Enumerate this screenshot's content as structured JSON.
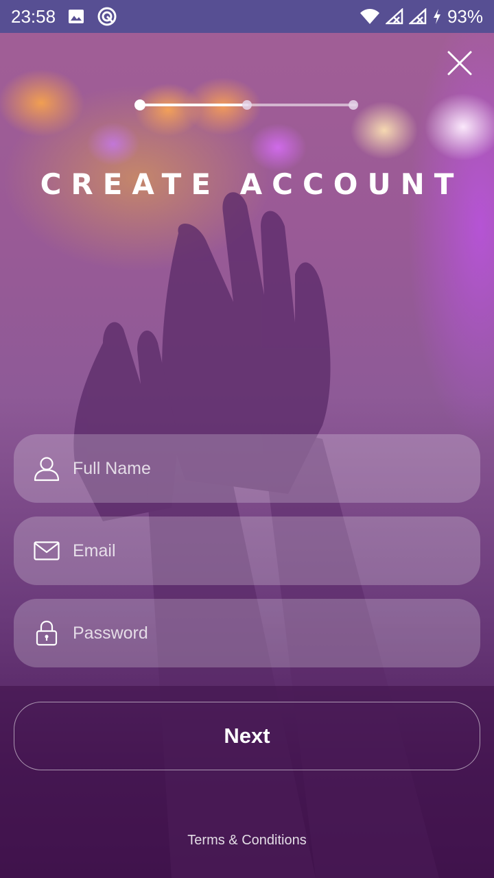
{
  "status_bar": {
    "time": "23:58",
    "battery_percent": "93%",
    "icons": [
      "image-icon",
      "sync-icon",
      "wifi-icon",
      "signal-1-icon",
      "signal-2-icon",
      "charging-icon"
    ]
  },
  "close_icon": "close-icon",
  "stepper": {
    "total_steps": 3,
    "current_step": 1,
    "progress_fraction": 0.5
  },
  "title": "CREATE ACCOUNT",
  "form": {
    "full_name": {
      "placeholder": "Full Name",
      "value": "",
      "icon": "user-icon"
    },
    "email": {
      "placeholder": "Email",
      "value": "",
      "icon": "mail-icon"
    },
    "password": {
      "placeholder": "Password",
      "value": "",
      "icon": "lock-icon"
    }
  },
  "next_label": "Next",
  "terms_label": "Terms & Conditions",
  "colors": {
    "status_bar": "#574f93",
    "background_top": "#a25f96",
    "background_bottom": "#431650",
    "text": "#ffffff"
  }
}
